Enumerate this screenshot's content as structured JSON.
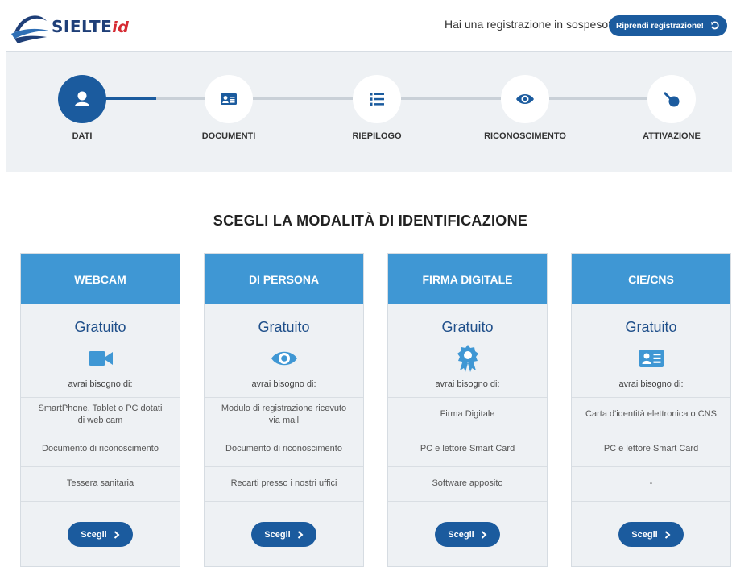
{
  "header": {
    "logo_text": "SIELTE",
    "logo_suffix": "id",
    "pending_question": "Hai una registrazione in sospeso?",
    "resume_button": "Riprendi registrazione!",
    "resume_icon": "undo-icon"
  },
  "stepper": {
    "active_index": 0,
    "steps": [
      {
        "label": "DATI",
        "icon": "user-icon"
      },
      {
        "label": "DOCUMENTI",
        "icon": "id-card-icon"
      },
      {
        "label": "RIEPILOGO",
        "icon": "list-icon"
      },
      {
        "label": "RICONOSCIMENTO",
        "icon": "eye-icon"
      },
      {
        "label": "ATTIVAZIONE",
        "icon": "key-icon"
      }
    ]
  },
  "title": "SCEGLI LA MODALITÀ DI IDENTIFICAZIONE",
  "cards": [
    {
      "heading": "WEBCAM",
      "price": "Gratuito",
      "icon": "video-camera-icon",
      "need": "avrai bisogno di:",
      "requirements": [
        "SmartPhone, Tablet o PC dotati di web cam",
        "Documento di riconoscimento",
        "Tessera sanitaria"
      ],
      "button": "Scegli"
    },
    {
      "heading": "DI PERSONA",
      "price": "Gratuito",
      "icon": "eye-icon",
      "need": "avrai bisogno di:",
      "requirements": [
        "Modulo di registrazione ricevuto via mail",
        "Documento di riconoscimento",
        "Recarti presso i nostri uffici"
      ],
      "button": "Scegli"
    },
    {
      "heading": "FIRMA DIGITALE",
      "price": "Gratuito",
      "icon": "certificate-icon",
      "need": "avrai bisogno di:",
      "requirements": [
        "Firma Digitale",
        "PC e lettore Smart Card",
        "Software apposito"
      ],
      "button": "Scegli"
    },
    {
      "heading": "CIE/CNS",
      "price": "Gratuito",
      "icon": "id-card-icon",
      "need": "avrai bisogno di:",
      "requirements": [
        "Carta d'identità elettronica o CNS",
        "PC e lettore Smart Card",
        "-"
      ],
      "button": "Scegli"
    }
  ],
  "colors": {
    "brand_blue": "#1b5b9e",
    "card_header": "#3f97d4",
    "panel_bg": "#eef1f4"
  }
}
